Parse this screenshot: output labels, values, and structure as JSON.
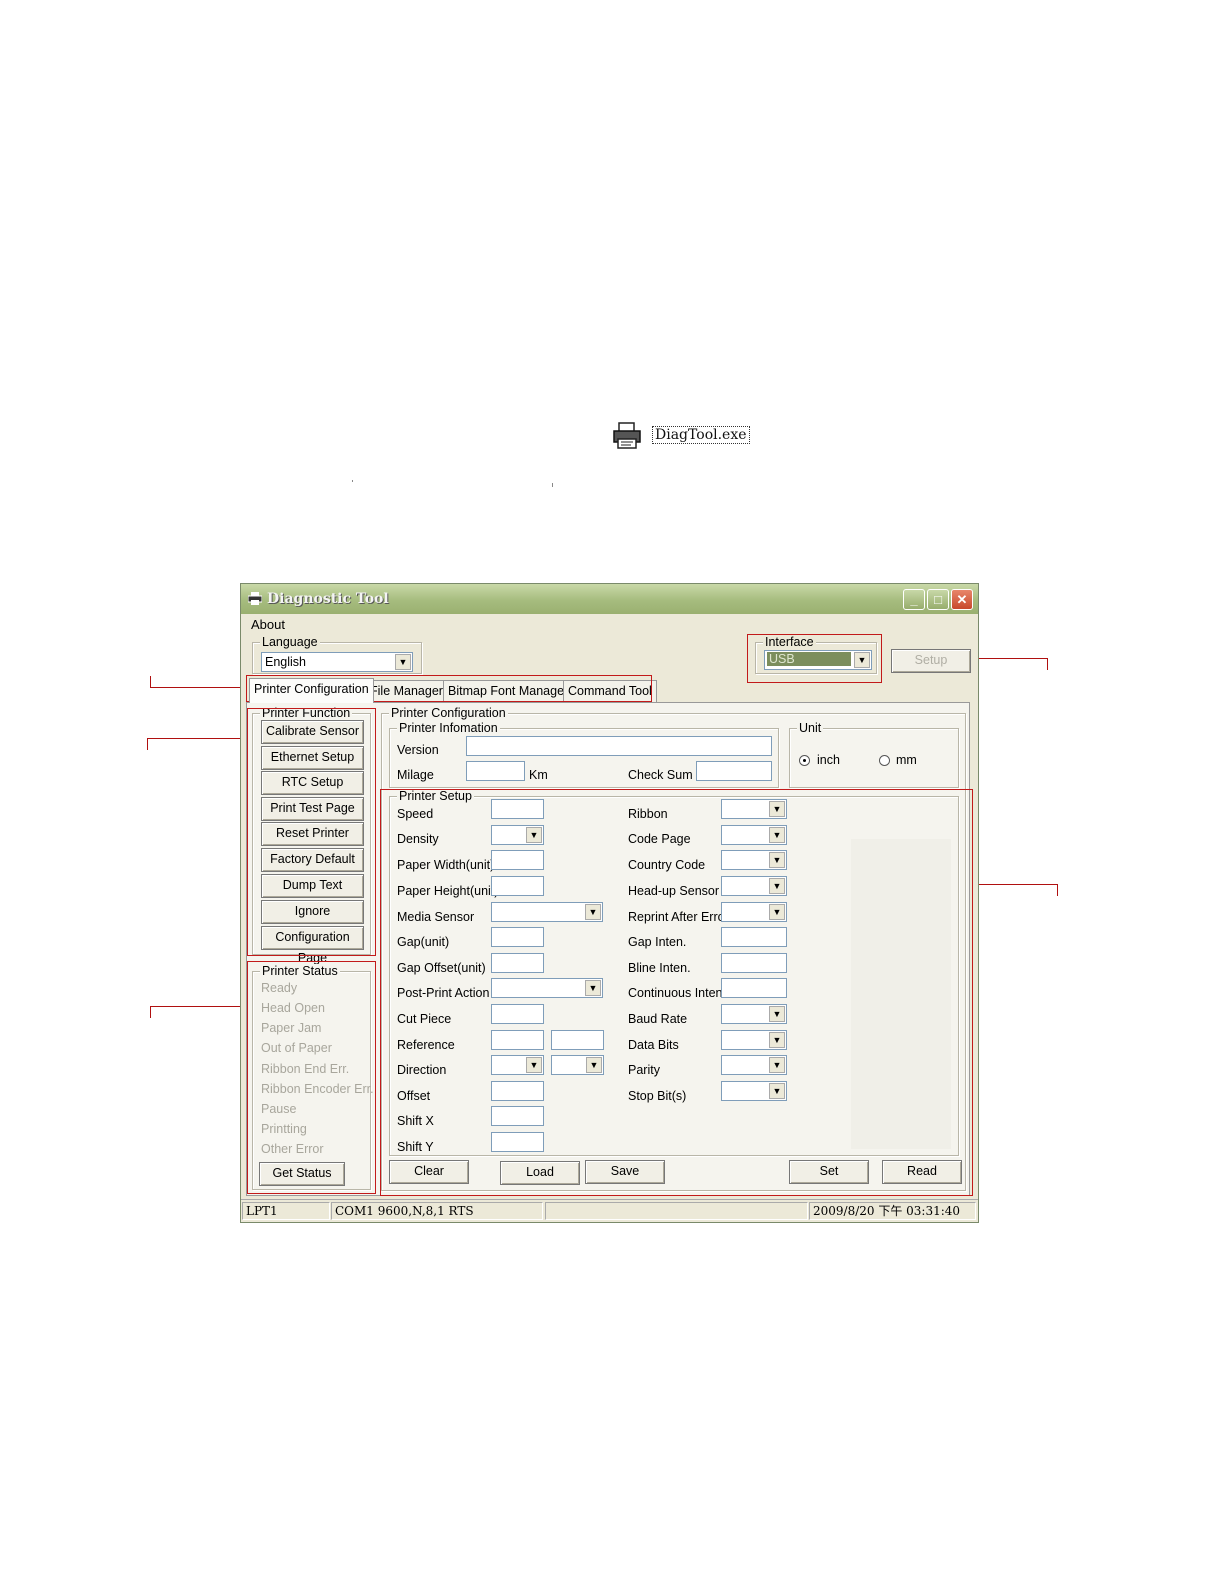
{
  "desktop_icon": {
    "label": "DiagTool.exe",
    "icon": "printer-icon"
  },
  "window": {
    "title": "Diagnostic Tool",
    "buttons": {
      "minimize": "_",
      "maximize": "□",
      "close": "✕"
    },
    "menu": {
      "about": "About"
    },
    "language": {
      "legend": "Language",
      "value": "English"
    },
    "interface": {
      "legend": "Interface",
      "value": "USB",
      "setup_button": "Setup"
    },
    "tabs": [
      "Printer Configuration",
      "File Manager",
      "Bitmap Font Manager",
      "Command Tool"
    ],
    "printer_function": {
      "legend": "Printer Function",
      "buttons": [
        "Calibrate Sensor",
        "Ethernet Setup",
        "RTC Setup",
        "Print Test Page",
        "Reset Printer",
        "Factory Default",
        "Dump Text",
        "Ignore AUTO.BAS",
        "Configuration Page"
      ]
    },
    "printer_status": {
      "legend": "Printer Status",
      "items": [
        "Ready",
        "Head Open",
        "Paper Jam",
        "Out of Paper",
        "Ribbon End Err.",
        "Ribbon Encoder Err.",
        "Pause",
        "Printting",
        "Other Error"
      ],
      "get_status_button": "Get Status"
    },
    "printer_configuration": {
      "legend": "Printer Configuration",
      "info": {
        "legend": "Printer Infomation",
        "version_label": "Version",
        "milage_label": "Milage",
        "milage_unit": "Km",
        "checksum_label": "Check Sum"
      },
      "unit": {
        "legend": "Unit",
        "inch": "inch",
        "mm": "mm",
        "selected": "inch"
      },
      "setup": {
        "legend": "Printer Setup",
        "left_labels": [
          "Speed",
          "Density",
          "Paper Width(unit)",
          "Paper Height(unit)",
          "Media Sensor",
          "Gap(unit)",
          "Gap Offset(unit)",
          "Post-Print Action",
          "Cut Piece",
          "Reference",
          "Direction",
          "Offset",
          "Shift X",
          "Shift Y"
        ],
        "right_labels": [
          "Ribbon",
          "Code Page",
          "Country Code",
          "Head-up Sensor",
          "Reprint After Error",
          "Gap Inten.",
          "Bline Inten.",
          "Continuous Inten.",
          "Baud Rate",
          "Data Bits",
          "Parity",
          "Stop Bit(s)"
        ]
      },
      "buttons": {
        "clear": "Clear",
        "load": "Load",
        "save": "Save",
        "set": "Set",
        "read": "Read"
      }
    },
    "statusbar": [
      "LPT1",
      "COM1 9600,N,8,1 RTS",
      "",
      "2009/8/20 下午 03:31:40"
    ]
  },
  "colors": {
    "titlebar": "#a6bc7e",
    "window_bg": "#ece9d8",
    "callout": "#c21a1a"
  }
}
